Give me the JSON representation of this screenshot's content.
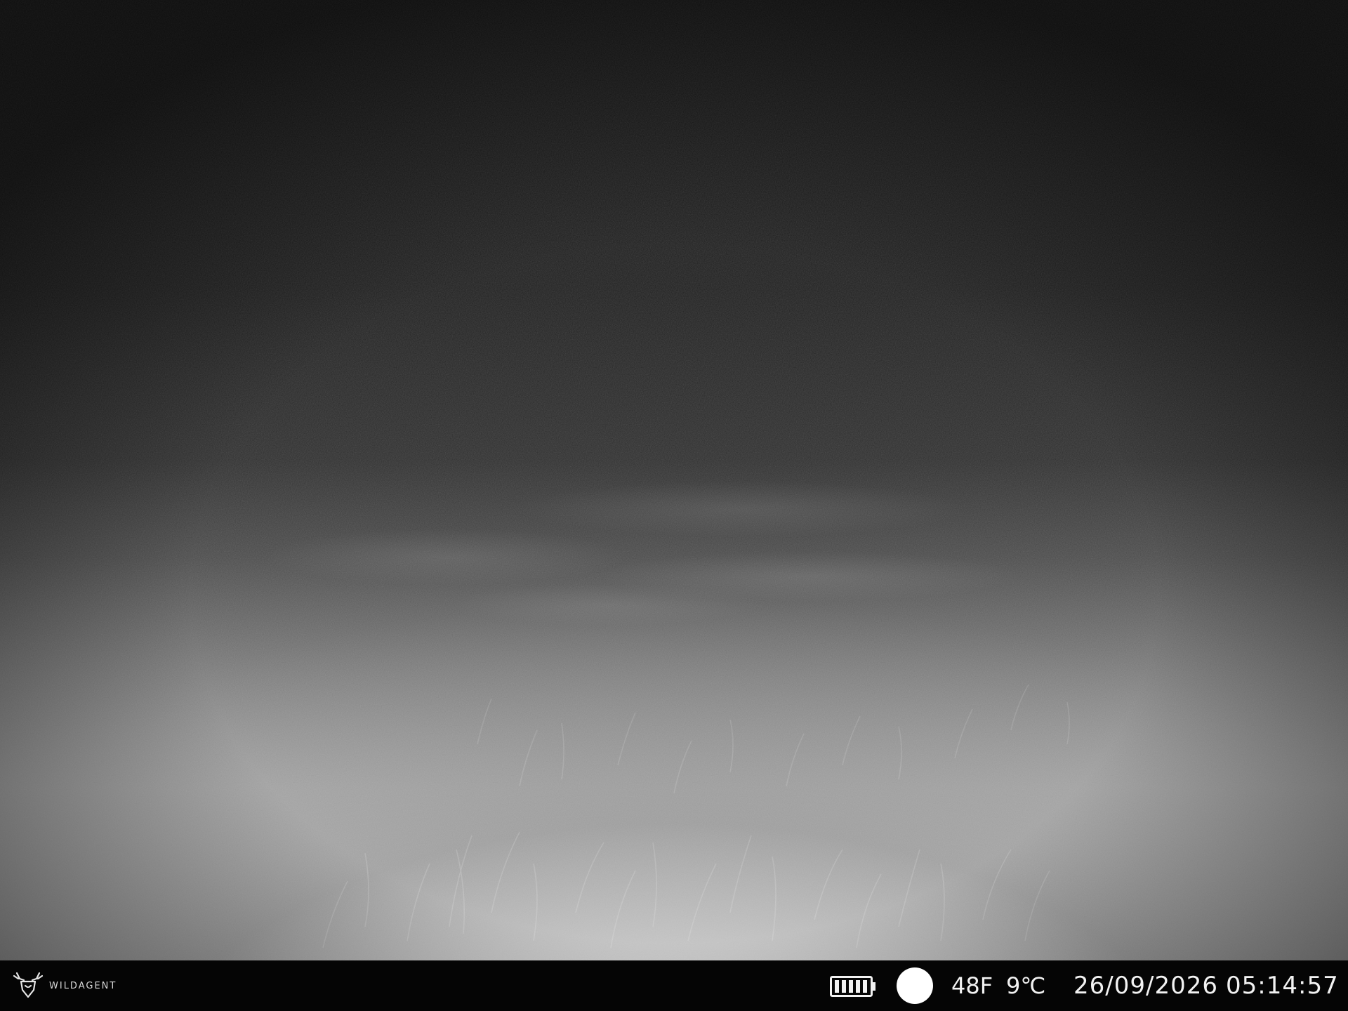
{
  "photo": {
    "description_tag": "trail-camera-night-photo"
  },
  "info_bar": {
    "brand_name": "WILDAGENT",
    "battery_icon": "battery-full-icon",
    "moon_icon": "full-moon-icon",
    "temperature_f": "48F",
    "temperature_c": "9℃",
    "date": "26/09/2026",
    "time": "05:14:57",
    "colors": {
      "bar_background": "#050505",
      "text": "#f2f2f2"
    }
  }
}
